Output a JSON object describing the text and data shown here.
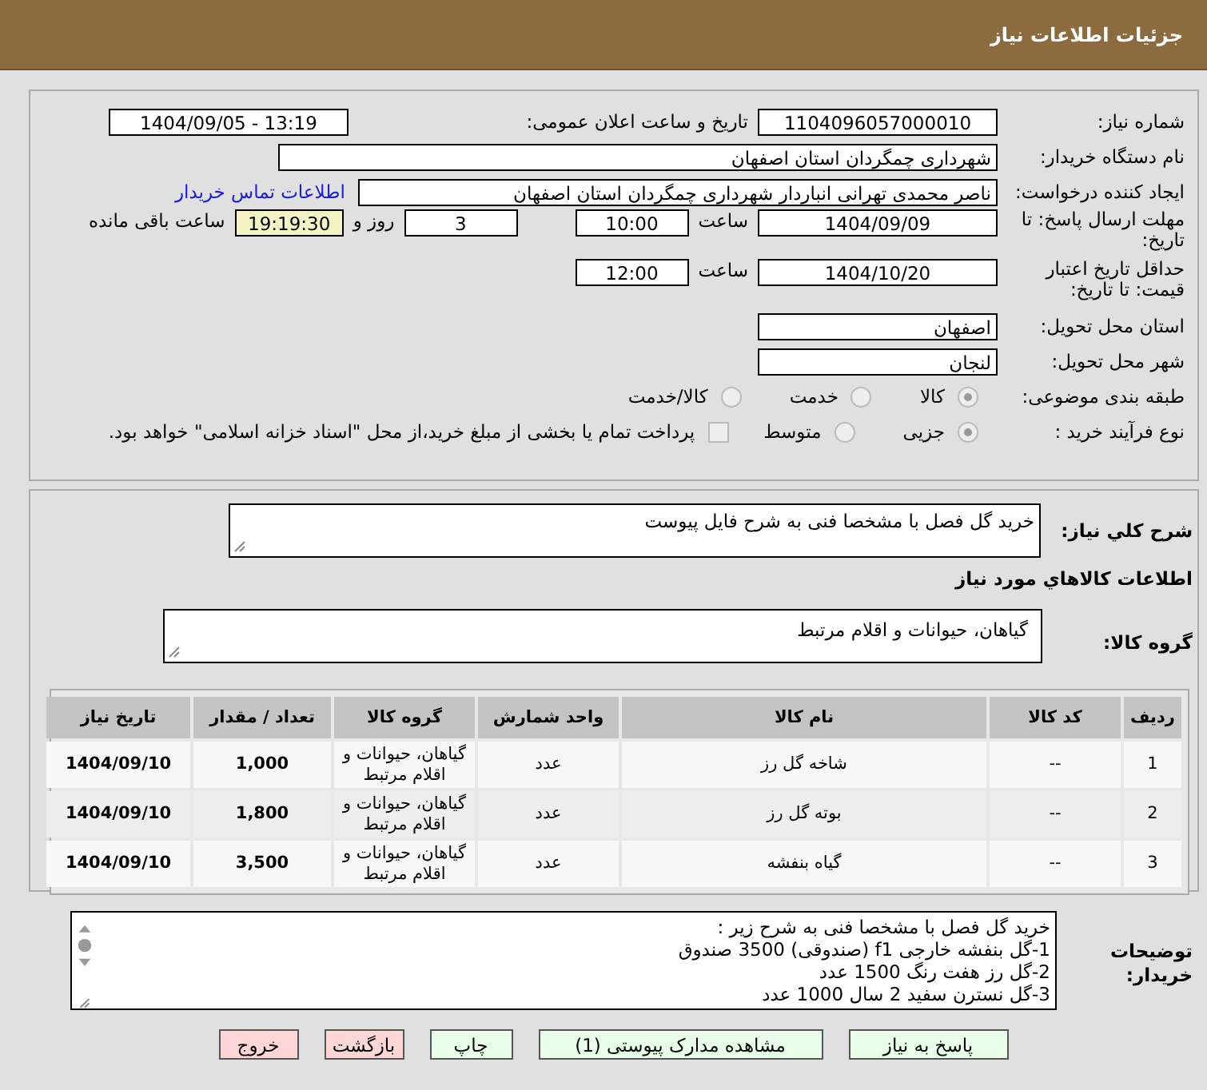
{
  "header": {
    "title": "جزئیات اطلاعات نیاز"
  },
  "need_number": {
    "label": "شماره نیاز:",
    "value": "1104096057000010"
  },
  "announce": {
    "label": "تاریخ و ساعت اعلان عمومی:",
    "value": "1404/09/05 - 13:19"
  },
  "buyer": {
    "label": "نام دستگاه خریدار:",
    "value": "شهرداری چمگردان استان اصفهان"
  },
  "creator": {
    "label": "ایجاد کننده درخواست:",
    "value": "ناصر محمدی تهرانی انباردار شهرداری چمگردان استان اصفهان",
    "link": "اطلاعات تماس خریدار"
  },
  "deadline": {
    "label": "مهلت ارسال پاسخ: تا تاریخ:",
    "date": "1404/09/09",
    "time_label": "ساعت",
    "time": "10:00",
    "days": "3",
    "days_label": "روز و",
    "remaining": "19:19:30",
    "remaining_label": "ساعت باقی مانده"
  },
  "validity": {
    "label": "حداقل تاریخ اعتبار قیمت: تا تاریخ:",
    "date": "1404/10/20",
    "time_label": "ساعت",
    "time": "12:00"
  },
  "province": {
    "label": "استان محل تحویل:",
    "value": "اصفهان"
  },
  "city": {
    "label": "شهر محل تحویل:",
    "value": "لنجان"
  },
  "category": {
    "label": "طبقه بندی موضوعی:",
    "options": [
      {
        "label": "کالا",
        "selected": true
      },
      {
        "label": "خدمت",
        "selected": false
      },
      {
        "label": "کالا/خدمت",
        "selected": false
      }
    ]
  },
  "process": {
    "label": "نوع فرآیند خرید :",
    "options": [
      {
        "label": "جزیی",
        "selected": true
      },
      {
        "label": "متوسط",
        "selected": false
      }
    ],
    "payment": {
      "label": "پرداخت تمام یا بخشی از مبلغ خرید،از محل \"اسناد خزانه اسلامی\" خواهد بود.",
      "checked": false
    }
  },
  "summary": {
    "label": "شرح کلي نياز:",
    "value": "خرید گل فصل با مشخصا فنی به شرح فایل پیوست"
  },
  "goods_title": "اطلاعات کالاهاي مورد نياز",
  "goods_group": {
    "label": "گروه کالا:",
    "value": "گیاهان، حیوانات و اقلام مرتبط"
  },
  "table": {
    "columns": [
      "ردیف",
      "کد کالا",
      "نام کالا",
      "واحد شمارش",
      "گروه کالا",
      "تعداد / مقدار",
      "تاریخ نیاز"
    ],
    "rows": [
      [
        "1",
        "--",
        "شاخه گل رز",
        "عدد",
        "گیاهان، حیوانات و اقلام مرتبط",
        "1,000",
        "1404/09/10"
      ],
      [
        "2",
        "--",
        "بوته گل رز",
        "عدد",
        "گیاهان، حیوانات و اقلام مرتبط",
        "1,800",
        "1404/09/10"
      ],
      [
        "3",
        "--",
        "گیاه بنفشه",
        "عدد",
        "گیاهان، حیوانات و اقلام مرتبط",
        "3,500",
        "1404/09/10"
      ]
    ]
  },
  "notes": {
    "label": "توضیحات خریدار:",
    "lines": [
      "خرید گل فصل با مشخصا فنی به شرح  زیر :",
      "1-گل بنفشه خارجی f1 (صندوقی)   3500 صندوق",
      "2-گل رز هفت رنگ  1500 عدد",
      "3-گل نسترن سفید 2 سال 1000 عدد"
    ]
  },
  "buttons": [
    {
      "label": "پاسخ به نیاز",
      "kind": "action"
    },
    {
      "label": "مشاهده مدارک پیوستی (1)",
      "kind": "action"
    },
    {
      "label": "چاپ",
      "kind": "action"
    },
    {
      "label": "بازگشت",
      "kind": "exit"
    },
    {
      "label": "خروج",
      "kind": "exit"
    }
  ]
}
